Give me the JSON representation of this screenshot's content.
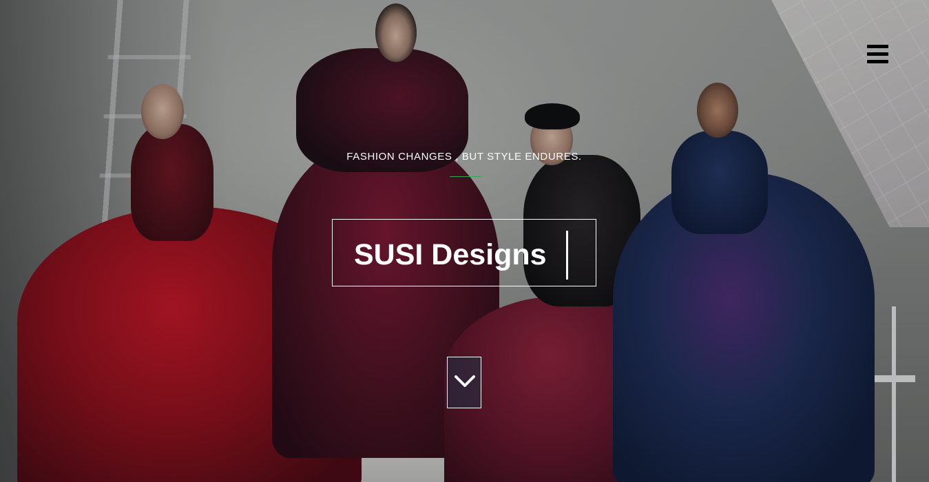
{
  "header": {
    "menu_icon": "hamburger-menu-icon"
  },
  "hero": {
    "tagline": "FASHION CHANGES , BUT STYLE ENDURES.",
    "title": "SUSI Designs",
    "scroll_icon": "chevron-down-icon",
    "accent_color": "#2ea84a"
  }
}
